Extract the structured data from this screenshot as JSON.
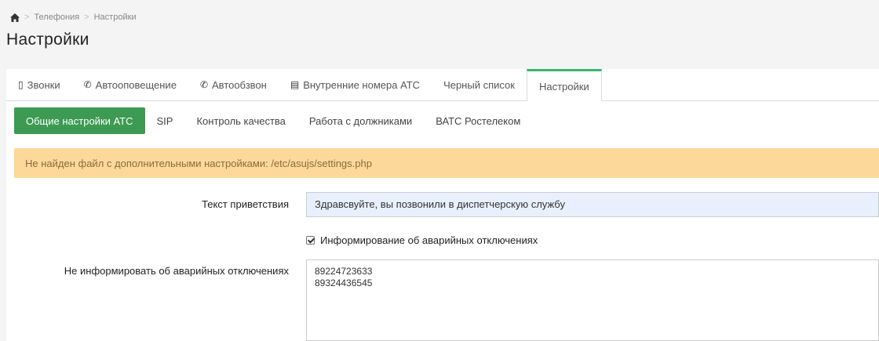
{
  "breadcrumb": {
    "home_icon": "home-icon",
    "separator": ">",
    "items": [
      "Телефония",
      "Настройки"
    ]
  },
  "page": {
    "title": "Настройки"
  },
  "tabs": [
    {
      "icon": "mobile-phone-icon",
      "glyph": "▯",
      "label": "Звонки",
      "active": false
    },
    {
      "icon": "phone-icon",
      "glyph": "✆",
      "label": "Автооповещение",
      "active": false
    },
    {
      "icon": "phone-icon",
      "glyph": "✆",
      "label": "Автообзвон",
      "active": false
    },
    {
      "icon": "list-icon",
      "glyph": "▤",
      "label": "Внутренние номера АТС",
      "active": false
    },
    {
      "icon": "",
      "glyph": "",
      "label": "Черный список",
      "active": false
    },
    {
      "icon": "",
      "glyph": "",
      "label": "Настройки",
      "active": true
    }
  ],
  "subtabs": [
    {
      "label": "Общие настройки АТС",
      "active": true
    },
    {
      "label": "SIP",
      "active": false
    },
    {
      "label": "Контроль качества",
      "active": false
    },
    {
      "label": "Работа с должниками",
      "active": false
    },
    {
      "label": "ВАТС Ростелеком",
      "active": false
    }
  ],
  "alert": {
    "text": "Не найден файл с дополнительными настройками: /etc/asujs/settings.php"
  },
  "form": {
    "greeting_label": "Текст приветствия",
    "greeting_value": "Здравсвуйте, вы позвонили в диспетчерскую службу",
    "checkbox_label": "Информирование об аварийных отключениях",
    "checkbox_checked": true,
    "exclude_label": "Не информировать об аварийных отключениях",
    "exclude_value": "89224723633\n89324436545"
  },
  "colors": {
    "accent": "#3d9a53",
    "tab_active_border": "#3cb371",
    "alert_bg": "#fcd89a",
    "alert_text": "#8a6d3b",
    "input_bg": "#e8f0fe"
  }
}
